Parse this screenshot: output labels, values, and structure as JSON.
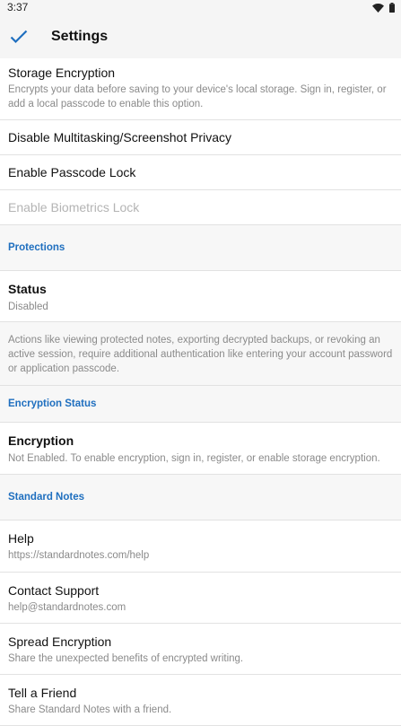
{
  "status_bar": {
    "time": "3:37"
  },
  "header": {
    "title": "Settings"
  },
  "storage_encryption": {
    "title": "Storage Encryption",
    "subtitle": "Encrypts your data before saving to your device's local storage. Sign in, register, or add a local passcode to enable this option."
  },
  "toggles": {
    "multitasking": "Disable Multitasking/Screenshot Privacy",
    "passcode": "Enable Passcode Lock",
    "biometrics": "Enable Biometrics Lock"
  },
  "protections": {
    "header": "Protections",
    "status_title": "Status",
    "status_value": "Disabled",
    "note": "Actions like viewing protected notes, exporting decrypted backups, or revoking an active session, require additional authentication like entering your account password or application passcode."
  },
  "encryption_status": {
    "header": "Encryption Status",
    "title": "Encryption",
    "value": "Not Enabled. To enable encryption, sign in, register, or enable storage encryption."
  },
  "standard_notes": {
    "header": "Standard Notes",
    "items": [
      {
        "title": "Help",
        "subtitle": "https://standardnotes.com/help"
      },
      {
        "title": "Contact Support",
        "subtitle": "help@standardnotes.com"
      },
      {
        "title": "Spread Encryption",
        "subtitle": "Share the unexpected benefits of encrypted writing."
      },
      {
        "title": "Tell a Friend",
        "subtitle": "Share Standard Notes with a friend."
      }
    ]
  },
  "colors": {
    "accent": "#1f6fbf",
    "subtext": "#8a8a8a",
    "disabled": "#b4b4b4"
  }
}
